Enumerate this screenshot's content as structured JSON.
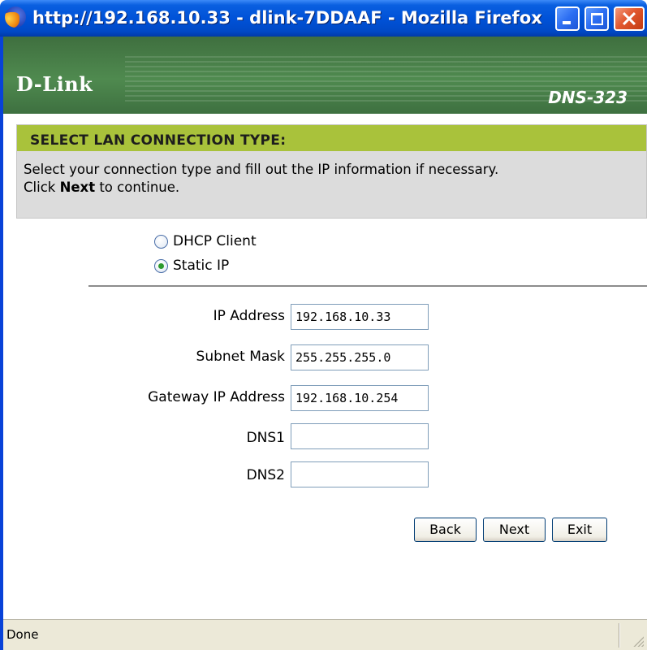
{
  "window": {
    "title": "http://192.168.10.33 - dlink-7DDAAF - Mozilla Firefox",
    "app_icon": "firefox-icon",
    "controls": [
      "minimize-icon",
      "maximize-icon",
      "close-icon"
    ]
  },
  "banner": {
    "logo": "D-Link",
    "model": "DNS-323"
  },
  "section": {
    "heading": "SELECT LAN CONNECTION TYPE:",
    "instruction_line1": "Select your connection type and fill out the IP information if necessary.",
    "instruction_line2_prefix": "Click ",
    "instruction_line2_bold": "Next",
    "instruction_line2_suffix": " to continue."
  },
  "connection_type": {
    "options": [
      {
        "label": "DHCP Client",
        "selected": false
      },
      {
        "label": "Static IP",
        "selected": true
      }
    ]
  },
  "form": {
    "ip_address": {
      "label": "IP Address",
      "value": "192.168.10.33"
    },
    "subnet_mask": {
      "label": "Subnet Mask",
      "value": "255.255.255.0"
    },
    "gateway": {
      "label": "Gateway IP Address",
      "value": "192.168.10.254"
    },
    "dns1": {
      "label": "DNS1",
      "value": ""
    },
    "dns2": {
      "label": "DNS2",
      "value": ""
    }
  },
  "buttons": {
    "back": "Back",
    "next": "Next",
    "exit": "Exit"
  },
  "statusbar": {
    "text": "Done"
  },
  "colors": {
    "titlebar": "#0052d8",
    "banner_green": "#4f8a4f",
    "section_header": "#a9c23b",
    "section_body": "#dcdcdc",
    "close_button": "#e2582f"
  }
}
